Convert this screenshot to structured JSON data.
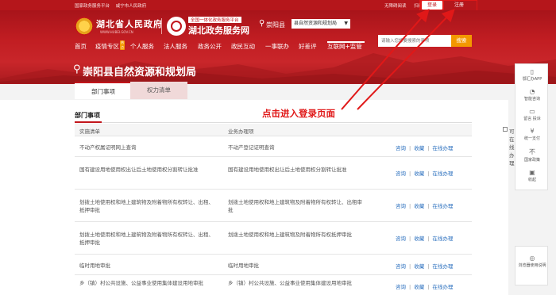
{
  "topbar": {
    "links": [
      "国家政务服务平台",
      "咸宁市人民政府"
    ],
    "right": [
      "无障碍阅读",
      "扫码登录"
    ],
    "login": "登录",
    "register": "注册"
  },
  "header": {
    "site1": "湖北省人民政府",
    "site1_en": "WWW.HUBEI.GOV.CN",
    "site2_tag": "全国一体化政务服务平台",
    "site2": "湖北政务服务网",
    "county": "崇阳县",
    "dept_select": "县自然资源和规划局",
    "search_placeholder": "请输入您想要搜索的事项",
    "search_button": "搜索",
    "title": "崇阳县自然资源和规划局"
  },
  "nav": [
    {
      "label": "首页"
    },
    {
      "label": "疫情专区",
      "badge": "热点"
    },
    {
      "label": "个人服务"
    },
    {
      "label": "法人服务"
    },
    {
      "label": "政务公开"
    },
    {
      "label": "政民互动"
    },
    {
      "label": "一事联办"
    },
    {
      "label": "好差评"
    },
    {
      "label": "互联网+监管"
    }
  ],
  "tabs": {
    "active": "部门事项",
    "inactive": "权力清单"
  },
  "section": {
    "title": "部门事项"
  },
  "annotation": "点击进入登录页面",
  "table": {
    "headers": [
      "实施清单",
      "业务办理项",
      "可在线办理"
    ],
    "actions": [
      "咨询",
      "收藏",
      "在线办理"
    ],
    "rows": [
      {
        "c1": "不动产权属证明网上查询",
        "c2": "不动产登记证明查询"
      },
      {
        "c1": "国有建设用地使用权出让后土地使用权分割转让批准",
        "c2": "国有建设用地使用权出让后土地使用权分割转让批准"
      },
      {
        "c1": "划拨土地使用权和地上建筑物及附着物所有权转让、出租、抵押审批",
        "c2": "划拨土地使用权和地上建筑物及附着物所有权转让、出租审批"
      },
      {
        "c1": "划拨土地使用权和地上建筑物及附着物所有权转让、出租、抵押审批",
        "c2": "划拨土地使用权和地上建筑物及附着物所有权抵押审批"
      },
      {
        "c1": "临时用地审批",
        "c2": "临时用地审批"
      },
      {
        "c1": "乡（镇）村公共设施、公益事业使用集体建设用地审批",
        "c2": "乡（镇）村公共设施、公益事业使用集体建设用地审批"
      }
    ]
  },
  "float": [
    {
      "icon": "▯",
      "label": "鄂汇办APP"
    },
    {
      "icon": "◔",
      "label": "智能咨询"
    },
    {
      "icon": "▭",
      "label": "留言 投诉"
    },
    {
      "icon": "¥",
      "label": "统一支付"
    },
    {
      "icon": "不",
      "label": "国家政策"
    },
    {
      "icon": "▣",
      "label": "收起"
    }
  ],
  "browser_hint": {
    "icon": "◎",
    "label": "浏览器使用说明"
  }
}
